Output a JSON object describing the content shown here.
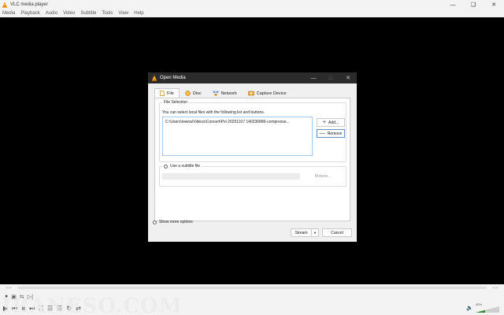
{
  "window": {
    "title": "VLC media player"
  },
  "menu": [
    "Media",
    "Playback",
    "Audio",
    "Video",
    "Subtitle",
    "Tools",
    "View",
    "Help"
  ],
  "seek": {
    "elapsed": "--:--",
    "remaining": "--:--"
  },
  "volume": {
    "percent_label": "40%",
    "level": 0.4
  },
  "watermark": "IRANESO.COM",
  "dialog": {
    "title": "Open Media",
    "tabs": [
      "File",
      "Disc",
      "Network",
      "Capture Device"
    ],
    "file_selection_label": "File Selection",
    "hint": "You can select local files with the following list and buttons.",
    "file_entry": "C:\\Users\\iowna\\Videos\\Concert\\Pxl 20251107 140236886-compresse...",
    "add_label": "Add...",
    "remove_label": "Remove",
    "subtitle_label": "Use a subtitle file",
    "browse_label": "Browse...",
    "more_options_label": "Show more options",
    "stream_label": "Stream",
    "cancel_label": "Cancel"
  },
  "colors": {
    "vlc_orange": "#f08a00",
    "dialog_titlebar": "#2b2b2b",
    "volume_fill": "#2e8b2e"
  }
}
